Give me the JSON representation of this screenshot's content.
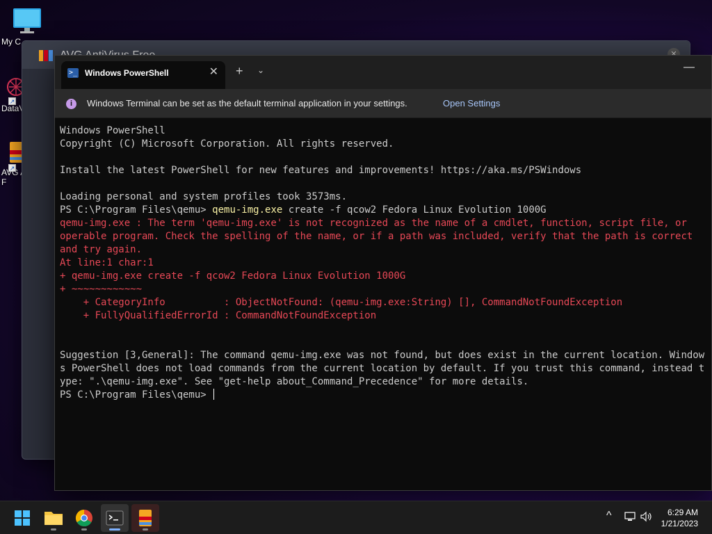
{
  "desktop": {
    "icons": [
      {
        "label": "My C",
        "icon": "monitor-icon"
      },
      {
        "label": "DataV",
        "icon": "datav-app-icon"
      },
      {
        "label": "AVG A F",
        "icon": "avg-antivirus-icon"
      }
    ]
  },
  "background_window": {
    "title": "AVG AntiVirus Free"
  },
  "terminal": {
    "tab_title": "Windows PowerShell",
    "tab_icon": "powershell-icon",
    "new_tab": "+",
    "infobar": {
      "message": "Windows Terminal can be set as the default terminal application in your settings.",
      "link": "Open Settings"
    },
    "lines": [
      {
        "text": "Windows PowerShell",
        "kind": "normal"
      },
      {
        "text": "Copyright (C) Microsoft Corporation. All rights reserved.",
        "kind": "normal"
      },
      {
        "text": "",
        "kind": "normal"
      },
      {
        "text": "Install the latest PowerShell for new features and improvements! https://aka.ms/PSWindows",
        "kind": "normal"
      },
      {
        "text": "",
        "kind": "normal"
      },
      {
        "text": "Loading personal and system profiles took 3573ms.",
        "kind": "normal"
      },
      {
        "prompt": "PS C:\\Program Files\\qemu> ",
        "command": "qemu-img.exe",
        "args": " create -f qcow2 Fedora Linux Evolution 1000G",
        "kind": "command"
      },
      {
        "text": "qemu-img.exe : The term 'qemu-img.exe' is not recognized as the name of a cmdlet, function, script file, or",
        "kind": "error"
      },
      {
        "text": "operable program. Check the spelling of the name, or if a path was included, verify that the path is correct",
        "kind": "error"
      },
      {
        "text": "and try again.",
        "kind": "error"
      },
      {
        "text": "At line:1 char:1",
        "kind": "error"
      },
      {
        "text": "+ qemu-img.exe create -f qcow2 Fedora Linux Evolution 1000G",
        "kind": "error"
      },
      {
        "text": "+ ~~~~~~~~~~~~",
        "kind": "error"
      },
      {
        "text": "    + CategoryInfo          : ObjectNotFound: (qemu-img.exe:String) [], CommandNotFoundException",
        "kind": "error"
      },
      {
        "text": "    + FullyQualifiedErrorId : CommandNotFoundException",
        "kind": "error"
      },
      {
        "text": "",
        "kind": "normal"
      },
      {
        "text": "",
        "kind": "normal"
      },
      {
        "text": "Suggestion [3,General]: The command qemu-img.exe was not found, but does exist in the current location. Window",
        "kind": "normal"
      },
      {
        "text": "s PowerShell does not load commands from the current location by default. If you trust this command, instead t",
        "kind": "normal"
      },
      {
        "text": "ype: \".\\qemu-img.exe\". See \"get-help about_Command_Precedence\" for more details.",
        "kind": "normal"
      },
      {
        "prompt": "PS C:\\Program Files\\qemu> ",
        "command": "",
        "args": "",
        "kind": "prompt"
      }
    ],
    "colors": {
      "text": "#cccccc",
      "error": "#e74856",
      "command": "#f9f1a5",
      "background": "#0c0c0c"
    }
  },
  "taskbar": {
    "apps": [
      {
        "name": "start-button",
        "icon": "windows-logo-icon",
        "active": false,
        "running": false
      },
      {
        "name": "file-explorer",
        "icon": "folder-icon",
        "active": false,
        "running": true
      },
      {
        "name": "chrome",
        "icon": "chrome-icon",
        "active": false,
        "running": true
      },
      {
        "name": "terminal",
        "icon": "terminal-icon",
        "active": true,
        "running": true
      },
      {
        "name": "avg",
        "icon": "avg-antivirus-icon",
        "active": false,
        "running": true
      }
    ],
    "tray": {
      "chevron": "^",
      "time": "6:29 AM",
      "date": "1/21/2023"
    }
  }
}
